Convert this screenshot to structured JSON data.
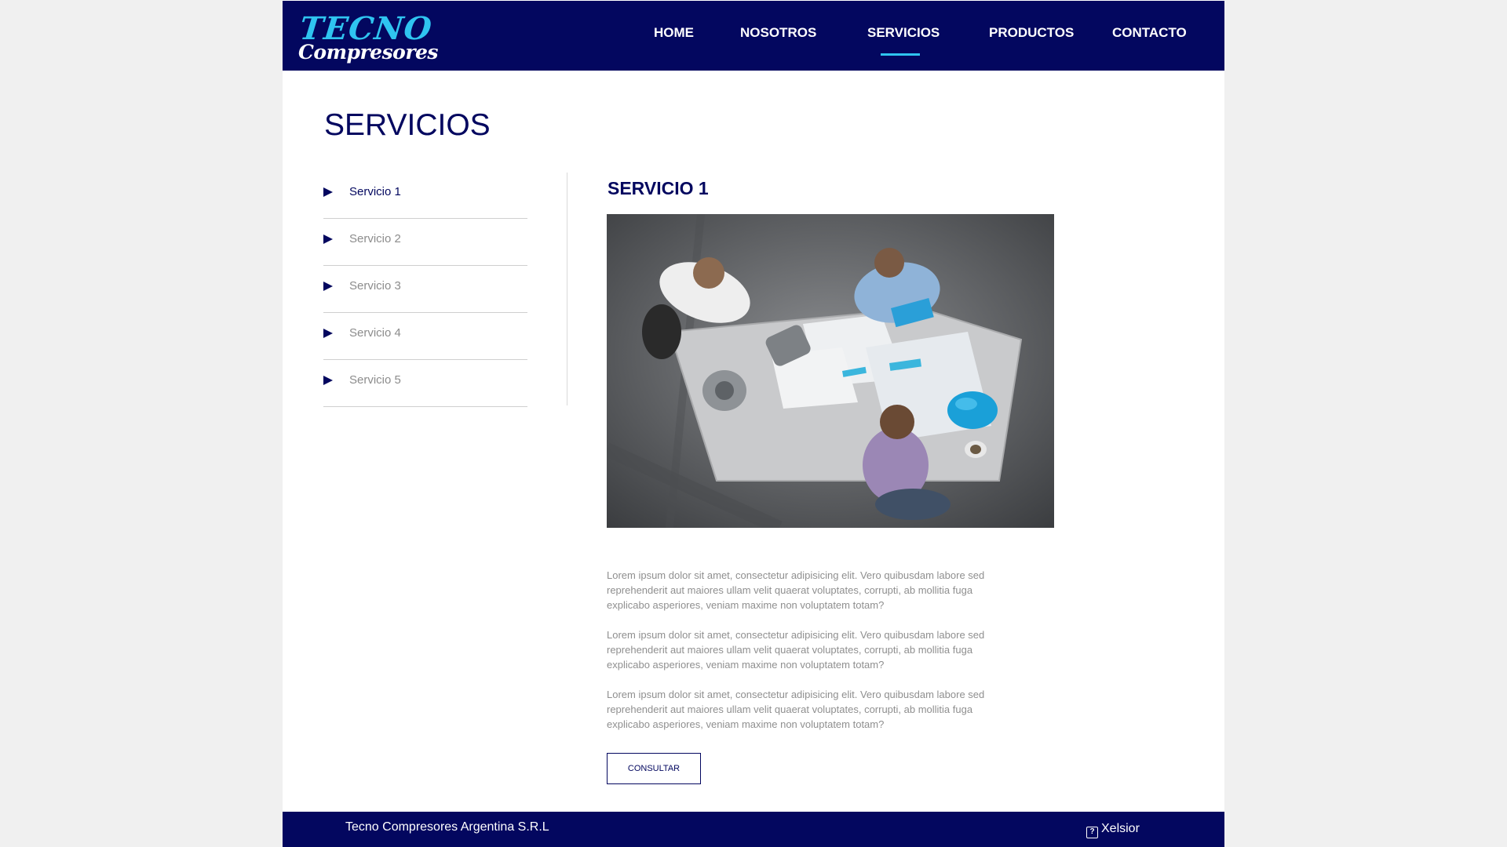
{
  "brand": {
    "logo_top": "TECNO",
    "logo_bottom": "Compresores",
    "colors": {
      "navy": "#03075f",
      "cyan": "#2fc4f0"
    }
  },
  "nav": {
    "items": [
      {
        "label": "HOME"
      },
      {
        "label": "NOSOTROS"
      },
      {
        "label": "SERVICIOS",
        "active": true
      },
      {
        "label": "PRODUCTOS"
      },
      {
        "label": "CONTACTO"
      }
    ]
  },
  "page": {
    "title": "SERVICIOS"
  },
  "sidebar": {
    "items": [
      {
        "label": "Servicio 1",
        "active": true
      },
      {
        "label": "Servicio 2"
      },
      {
        "label": "Servicio 3"
      },
      {
        "label": "Servicio 4"
      },
      {
        "label": "Servicio 5"
      }
    ],
    "arrow_icon": "play-arrow-icon"
  },
  "main": {
    "title": "SERVICIO 1",
    "image": "photo-team-meeting-overhead",
    "paragraphs": [
      "Lorem ipsum dolor sit amet, consectetur adipisicing elit. Vero quibusdam labore sed reprehenderit aut maiores ullam velit quaerat voluptates, corrupti, ab mollitia fuga explicabo asperiores, veniam maxime non voluptatem totam?",
      "Lorem ipsum dolor sit amet, consectetur adipisicing elit. Vero quibusdam labore sed reprehenderit aut maiores ullam velit quaerat voluptates, corrupti, ab mollitia fuga explicabo asperiores, veniam maxime non voluptatem totam?",
      "Lorem ipsum dolor sit amet, consectetur adipisicing elit. Vero quibusdam labore sed reprehenderit aut maiores ullam velit quaerat voluptates, corrupti, ab mollitia fuga explicabo asperiores, veniam maxime non voluptatem totam?"
    ],
    "button_label": "CONSULTAR"
  },
  "footer": {
    "company": "Tecno Compresores Argentina S.R.L",
    "credit_icon": "question-box-icon",
    "credit_icon_glyph": "?",
    "credit": "Xelsior"
  }
}
